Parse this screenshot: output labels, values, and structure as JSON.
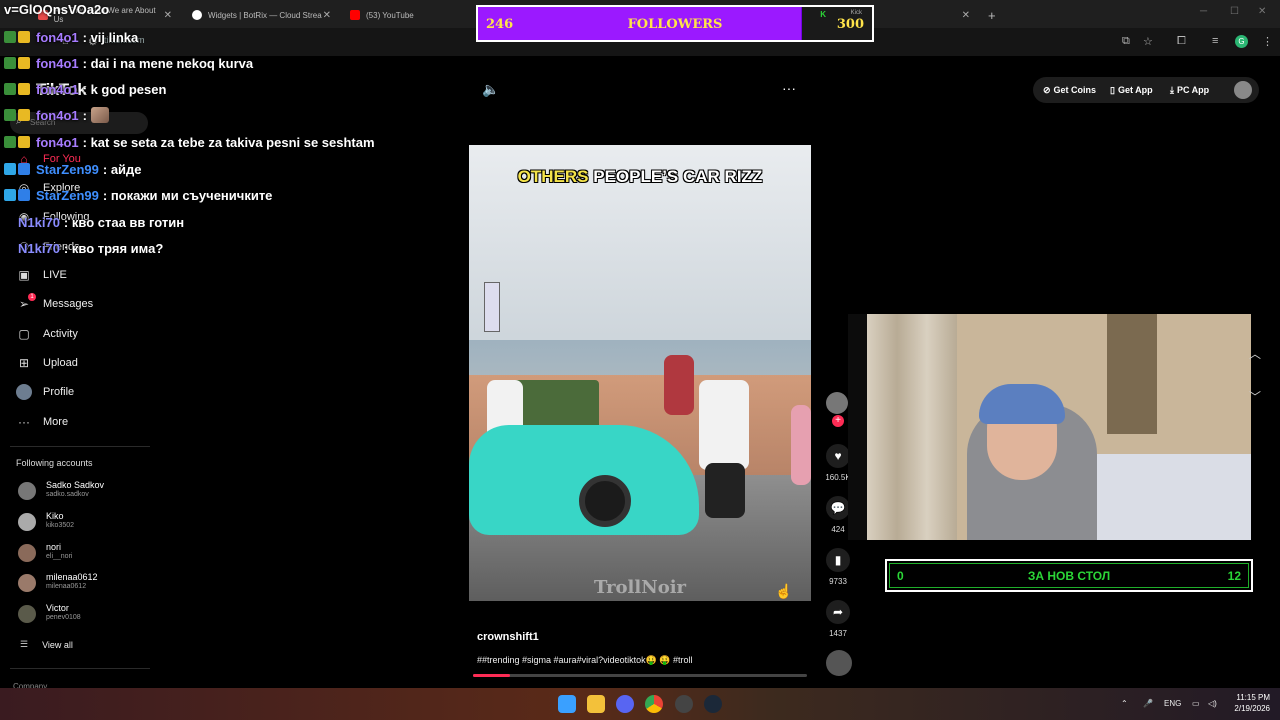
{
  "browser": {
    "tabs": [
      {
        "label": "Are They Glad We are About Us",
        "color": "#e84b4b"
      },
      {
        "label": "Widgets | BotRix — Cloud Strea",
        "color": "#ffffff"
      },
      {
        "label": "(53) YouTube",
        "color": "#ff0000"
      }
    ],
    "url": "tiktok.com",
    "new_tab": "+",
    "close": "✕"
  },
  "stream_title": "v=GlOQnsVOa2o",
  "chat": [
    {
      "user": "fon4o1",
      "color": "#a77cff",
      "text": ": vij linka",
      "badge": "#e8b923"
    },
    {
      "user": "fon4o1",
      "color": "#a77cff",
      "text": ": dai i na mene nekoq kurva",
      "badge": "#e8b923"
    },
    {
      "user": "fon4o1",
      "color": "#a77cff",
      "text": ": k god pesen",
      "badge": "#e8b923"
    },
    {
      "user": "fon4o1",
      "color": "#a77cff",
      "text": ":",
      "badge": "#e8b923"
    },
    {
      "user": "fon4o1",
      "color": "#a77cff",
      "text": ": kat se seta za tebe za takiva pesni se seshtam",
      "badge": "#e8b923"
    },
    {
      "user": "StarZen99",
      "color": "#3f8fff",
      "text": ": айде",
      "badge": "#2fa7e8"
    },
    {
      "user": "StarZen99",
      "color": "#3f8fff",
      "text": ": покажи ми съученичките",
      "badge": "#2fa7e8"
    },
    {
      "user": "N1ki70",
      "color": "#8a8cff",
      "text": ": кво стаа вв готин",
      "badge": "#2fa7e8"
    },
    {
      "user": "N1ki70",
      "color": "#8a8cff",
      "text": ": кво тряя има?",
      "badge": "#2fa7e8"
    }
  ],
  "followers_widget": {
    "current": "246",
    "label": "FOLLOWERS",
    "goal": "300",
    "progress": 0.82,
    "kick": "Kick"
  },
  "tiktok": {
    "logo": "TikTok",
    "search_placeholder": "Search",
    "nav": [
      {
        "label": "For You",
        "icon": "home-icon"
      },
      {
        "label": "Explore",
        "icon": "compass-icon"
      },
      {
        "label": "Following",
        "icon": "following-icon"
      },
      {
        "label": "Friends",
        "icon": "friends-icon"
      },
      {
        "label": "LIVE",
        "icon": "live-icon"
      },
      {
        "label": "Messages",
        "icon": "messages-icon",
        "badge": "1"
      },
      {
        "label": "Activity",
        "icon": "activity-icon"
      },
      {
        "label": "Upload",
        "icon": "upload-icon"
      },
      {
        "label": "Profile",
        "icon": "profile-icon"
      },
      {
        "label": "More",
        "icon": "more-icon"
      }
    ],
    "following_title": "Following accounts",
    "accounts": [
      {
        "name": "Sadko Sadkov",
        "handle": "sadko.sadkov"
      },
      {
        "name": "Kiko",
        "handle": "kiko3502"
      },
      {
        "name": "nori",
        "handle": "eli__nori"
      },
      {
        "name": "milenaa0612",
        "handle": "milenaa0612"
      },
      {
        "name": "Victor",
        "handle": "penev0108"
      }
    ],
    "view_all": "View all",
    "company": "Company",
    "top_buttons": {
      "coins": "Get Coins",
      "app": "Get App",
      "pc": "PC App"
    },
    "video": {
      "caption_highlight": "OTHERS",
      "caption_rest": " PEOPLE’S CAR RIZZ",
      "watermark": "TrollNoir",
      "author": "crownshift1",
      "tags": "##trending #sigma #aura#viral?videotiktok🤑 🤑 #troll",
      "progress": 0.11
    },
    "actions": {
      "likes": "160.5K",
      "comments": "424",
      "saves": "9733",
      "shares": "1437"
    }
  },
  "counter_widget": {
    "left": "0",
    "label": "ЗА НОВ СТОЛ",
    "right": "12"
  },
  "taskbar": {
    "lang": "ENG",
    "time": "11:15 PM",
    "date": "2/19/2026"
  }
}
